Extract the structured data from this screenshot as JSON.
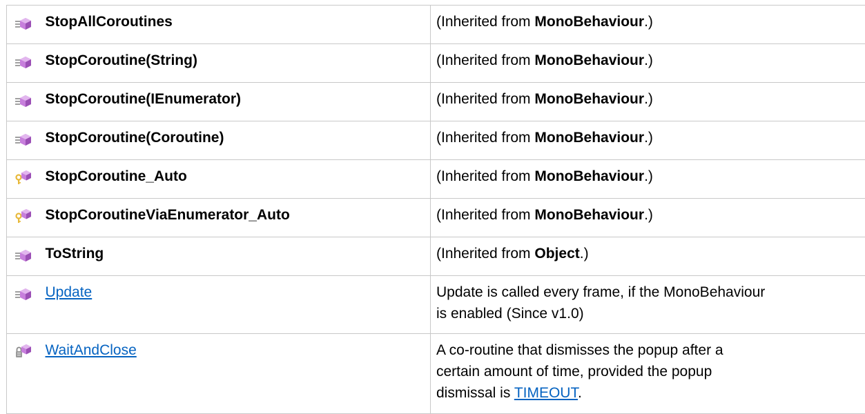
{
  "rows": [
    {
      "icon": "public-method-icon",
      "name": "StopAllCoroutines",
      "desc_prefix": "(Inherited from ",
      "desc_bold": "MonoBehaviour",
      "desc_suffix": ".)"
    },
    {
      "icon": "public-method-icon",
      "name": "StopCoroutine(String)",
      "desc_prefix": "(Inherited from ",
      "desc_bold": "MonoBehaviour",
      "desc_suffix": ".)"
    },
    {
      "icon": "public-method-icon",
      "name": "StopCoroutine(IEnumerator)",
      "desc_prefix": "(Inherited from ",
      "desc_bold": "MonoBehaviour",
      "desc_suffix": ".)"
    },
    {
      "icon": "public-method-icon",
      "name": "StopCoroutine(Coroutine)",
      "desc_prefix": "(Inherited from ",
      "desc_bold": "MonoBehaviour",
      "desc_suffix": ".)"
    },
    {
      "icon": "internal-method-icon",
      "name": "StopCoroutine_Auto",
      "desc_prefix": "(Inherited from ",
      "desc_bold": "MonoBehaviour",
      "desc_suffix": ".)"
    },
    {
      "icon": "internal-method-icon",
      "name": "StopCoroutineViaEnumerator_Auto",
      "desc_prefix": "(Inherited from ",
      "desc_bold": "MonoBehaviour",
      "desc_suffix": ".)"
    },
    {
      "icon": "public-method-icon",
      "name": "ToString",
      "desc_prefix": "(Inherited from ",
      "desc_bold": "Object",
      "desc_suffix": ".)"
    },
    {
      "icon": "public-method-icon",
      "name": "Update",
      "desc_line1": "Update is called every frame, if the MonoBehaviour",
      "desc_line2": "is enabled (Since v1.0)"
    },
    {
      "icon": "private-method-icon",
      "name": "WaitAndClose",
      "desc_line1": "A co-routine that dismisses the popup after a",
      "desc_line2": "certain amount of time, provided the popup",
      "desc_line3_prefix": "dismissal is ",
      "desc_line3_link": "TIMEOUT",
      "desc_line3_suffix": "."
    }
  ],
  "colors": {
    "link": "#0563c1",
    "border": "#c8c8c8",
    "method_purple": "#c77fdc",
    "key_yellow": "#e8b93a",
    "lock_gray": "#8a8a8a"
  }
}
